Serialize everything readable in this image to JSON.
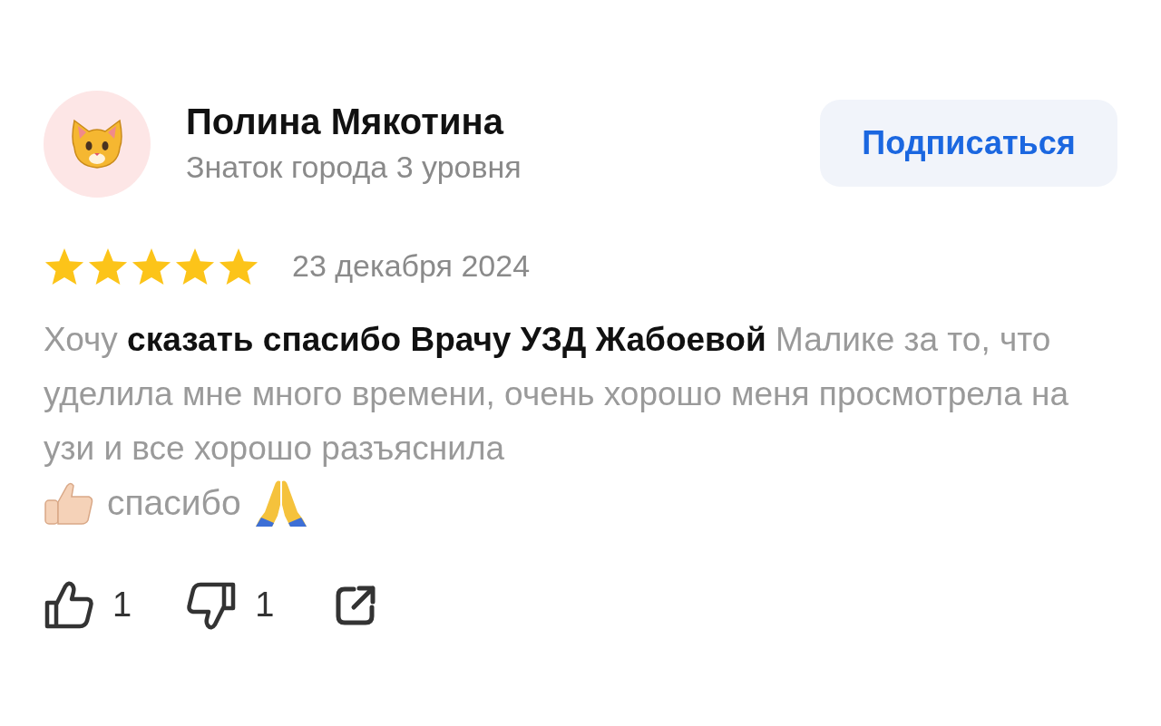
{
  "author": {
    "name": "Полина Мякотина",
    "level": "Знаток города 3 уровня"
  },
  "subscribe_button": "Подписаться",
  "review": {
    "stars": 5,
    "date": "23 декабря 2024",
    "text": "Хочу **сказать спасибо Врачу УЗД Жабоевой** Малике за то, что уделила мне много времени, очень хорошо меня просмотрела на узи и все хорошо разъяснила",
    "closing": "спасибо"
  },
  "actions": {
    "likes": "1",
    "dislikes": "1"
  }
}
